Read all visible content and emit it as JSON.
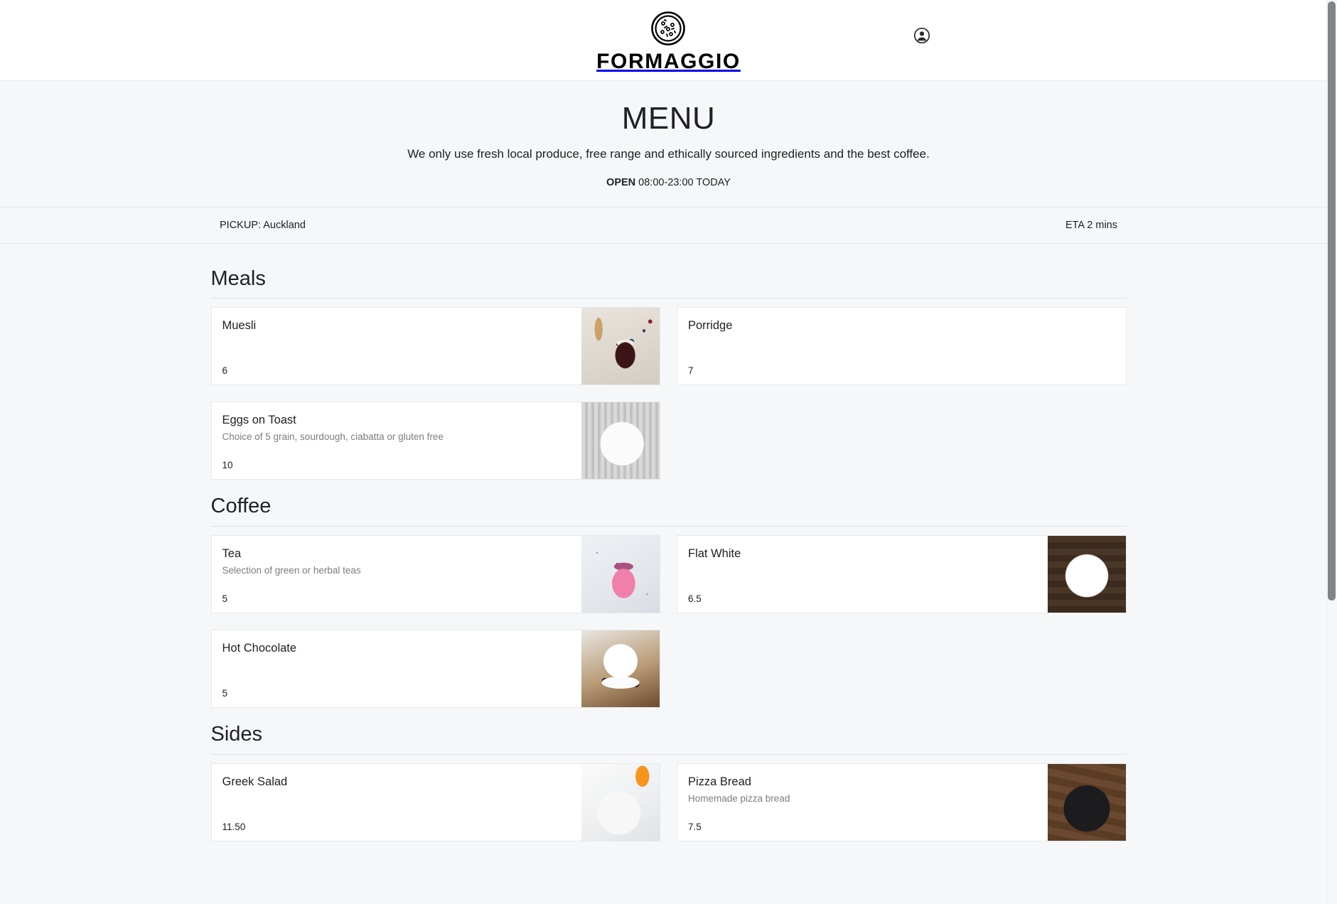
{
  "header": {
    "brand_name": "FORMAGGIO",
    "logo_icon": "pizza-circle-icon",
    "account_icon": "account-circle-icon"
  },
  "hero": {
    "title": "MENU",
    "subtitle": "We only use fresh local produce, free range and ethically sourced ingredients and the best coffee.",
    "open_label": "OPEN",
    "hours": " 08:00-23:00 TODAY"
  },
  "pickup_bar": {
    "pickup": "PICKUP: Auckland",
    "eta": "ETA 2 mins"
  },
  "sections": [
    {
      "title": "Meals",
      "items": [
        {
          "name": "Muesli",
          "desc": "",
          "price": "6",
          "photo": "muesli-parfait-photo"
        },
        {
          "name": "Porridge",
          "desc": "",
          "price": "7",
          "photo": "porridge-bowl-photo"
        },
        {
          "name": "Eggs on Toast",
          "desc": "Choice of 5 grain, sourdough, ciabatta or gluten free",
          "price": "10",
          "photo": "eggs-on-toast-photo"
        }
      ]
    },
    {
      "title": "Coffee",
      "items": [
        {
          "name": "Tea",
          "desc": "Selection of green or herbal teas",
          "price": "5",
          "photo": "herbal-tea-photo"
        },
        {
          "name": "Flat White",
          "desc": "",
          "price": "6.5",
          "photo": "flat-white-latte-art-photo"
        },
        {
          "name": "Hot Chocolate",
          "desc": "",
          "price": "5",
          "photo": "hot-chocolate-photo"
        }
      ]
    },
    {
      "title": "Sides",
      "items": [
        {
          "name": "Greek Salad",
          "desc": "",
          "price": "11.50",
          "photo": "greek-salad-photo"
        },
        {
          "name": "Pizza Bread",
          "desc": "Homemade pizza bread",
          "price": "7.5",
          "photo": "pizza-bread-photo"
        }
      ]
    }
  ],
  "colors": {
    "page_background": "#f6f7f9",
    "card_background": "#ffffff",
    "text_primary": "#202124",
    "text_muted": "#7a7d81",
    "border": "#e6e8eb"
  }
}
